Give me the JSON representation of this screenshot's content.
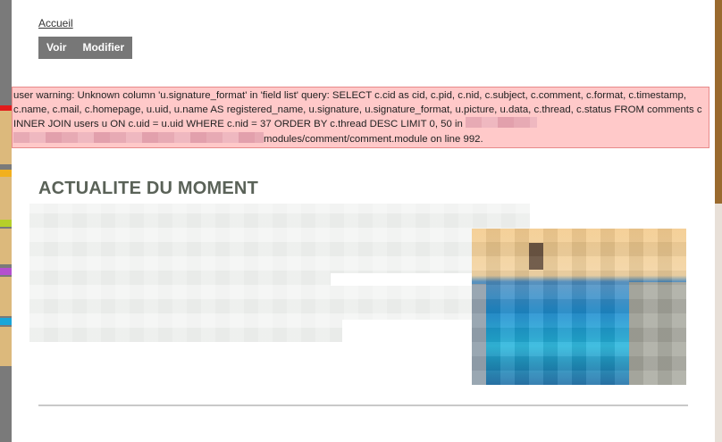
{
  "breadcrumb": {
    "home_label": "Accueil"
  },
  "tabs": [
    {
      "label": "Voir"
    },
    {
      "label": "Modifier"
    }
  ],
  "warning": {
    "text_before_path": "user warning: Unknown column 'u.signature_format' in 'field list' query: SELECT c.cid as cid, c.pid, c.nid, c.subject, c.comment, c.format, c.timestamp, c.name, c.mail, c.homepage, u.uid, u.name AS registered_name, u.signature, u.signature_format, u.picture, u.data, c.thread, c.status FROM comments c INNER JOIN users u ON c.uid = u.uid WHERE c.nid = 37 ORDER BY c.thread DESC LIMIT 0, 50 in",
    "text_after_path": "modules/comment/comment.module on line 992."
  },
  "section": {
    "title": "ACTUALITE DU MOMENT"
  },
  "colors": {
    "tab_bg": "#777777",
    "warning_bg": "#ffc9c9",
    "warning_border": "#e88a8a",
    "title_color": "#5a6258"
  }
}
